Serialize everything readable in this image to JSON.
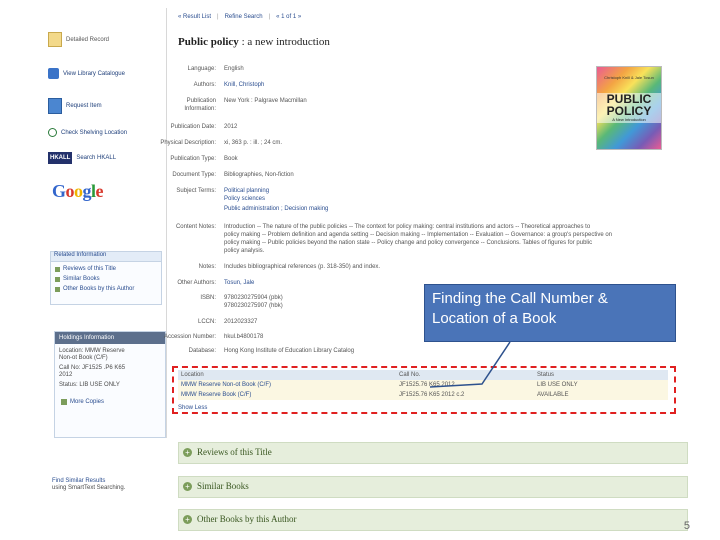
{
  "nav": {
    "result_list": "« Result List",
    "refine_search": "Refine Search",
    "pager": "« 1 of 1 »"
  },
  "record": {
    "title_main": "Public policy",
    "title_sub": " : a new introduction"
  },
  "sidebar": {
    "detailed_record": "Detailed Record",
    "view_catalogue": "View Library Catalogue",
    "request_item": "Request Item",
    "check_location": "Check Shelving Location",
    "hkall_logo": "HKALL",
    "search_hkall": "Search HKALL",
    "google_logo": "Google",
    "related_header": "Related Information",
    "related_items": [
      "Reviews of this Title",
      "Similar Books",
      "Other Books by this Author"
    ],
    "holdings_header": "Holdings Information",
    "holdings_lines": [
      "Location: MMW Reserve",
      "Non-ot Book (C/F)",
      "Call No: JF1525 .P6 K65",
      "2012",
      "Status: LIB USE ONLY"
    ],
    "more_copies": "More Copies",
    "find_similar": "Find Similar Results",
    "smart_text": "using SmartText Searching."
  },
  "fields": [
    {
      "label": "Language:",
      "value": "English"
    },
    {
      "label": "Authors:",
      "value": "Knill, Christoph"
    },
    {
      "label": "Publication",
      "value": "New York : Palgrave Macmillan"
    },
    {
      "label": "Information:",
      "value": ""
    },
    {
      "label": "Publication Date:",
      "value": "2012"
    },
    {
      "label": "Physical Description:",
      "value": "xi, 363 p. : ill. ; 24 cm."
    },
    {
      "label": "Publication Type:",
      "value": "Book"
    },
    {
      "label": "Document Type:",
      "value": "Bibliographies, Non-fiction"
    },
    {
      "label": "Subject Terms:",
      "value": "Political planning"
    },
    {
      "label": "",
      "value": "Policy sciences"
    },
    {
      "label": "",
      "value": "Public administration ; Decision making"
    },
    {
      "label": "Content Notes:",
      "value": "Introduction -- The nature of the public policies -- The context for policy making: central institutions and actors -- Theoretical approaches to"
    },
    {
      "label": "",
      "value": "policy making -- Problem definition and agenda setting -- Decision making -- Implementation -- Evaluation -- Governance: a group's perspective on"
    },
    {
      "label": "",
      "value": "policy making -- Public policies beyond the nation state -- Policy change and policy convergence -- Conclusions. Tables of figures for public"
    },
    {
      "label": "",
      "value": "policy analysis."
    },
    {
      "label": "Notes:",
      "value": "Includes bibliographical references (p. 318-350) and index."
    },
    {
      "label": "Other Authors:",
      "value": "Tosun, Jale"
    },
    {
      "label": "ISBN:",
      "value": "9780230275904 (pbk)"
    },
    {
      "label": "",
      "value": "9780230275907 (hbk)"
    },
    {
      "label": "LCCN:",
      "value": "2012023327"
    },
    {
      "label": "Accession Number:",
      "value": "hkul.b4800178"
    },
    {
      "label": "Database:",
      "value": "Hong Kong Institute of Education Library Catalog"
    }
  ],
  "book_cover": {
    "authors": "Christoph Knill & Jale Tosun",
    "title_line1": "PUBLIC",
    "title_line2": "POLICY",
    "subtitle": "A New Introduction"
  },
  "holdings_table": {
    "headers": [
      "Location",
      "Call No.",
      "Status"
    ],
    "rows": [
      [
        "MMW Reserve Non-ot Book (C/F)",
        "JF1525.76 K65 2012",
        "LIB USE ONLY"
      ],
      [
        "MMW Reserve Book (C/F)",
        "JF1525.76 K65 2012 c.2",
        "AVAILABLE"
      ]
    ],
    "show_more": "Show Less"
  },
  "sections": [
    "Reviews of this Title",
    "Similar Books",
    "Other Books by this Author"
  ],
  "callout": {
    "line1": "Finding the Call Number &",
    "line2": "Location of a Book"
  },
  "slide_number": "5",
  "colors": {
    "callout_fill": "#4a74b8",
    "highlight_border": "#e02020",
    "section_text": "#38561f",
    "section_bg": "#e6eedc"
  }
}
